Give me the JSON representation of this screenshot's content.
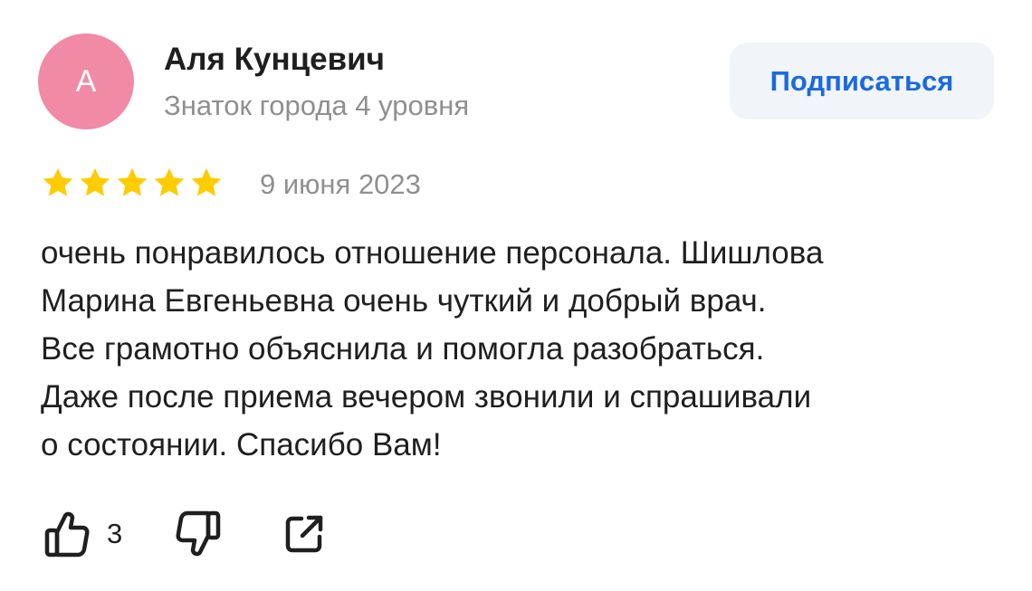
{
  "colors": {
    "avatar_bg": "#f08aa5",
    "accent": "#1a6ae0",
    "star": "#ffcc00",
    "muted": "#8f8f8f",
    "icon": "#1f1f1f"
  },
  "author": {
    "avatar_letter": "А",
    "name": "Аля Кунцевич",
    "level": "Знаток города 4 уровня"
  },
  "subscribe_label": "Подписаться",
  "rating": {
    "value": 5,
    "max": 5
  },
  "date": "9 июня 2023",
  "text_lines": [
    "очень понравилось отношение персонала. Шишлова",
    "Марина Евгеньевна очень чуткий и добрый врач.",
    "Все грамотно объяснила и помогла разобраться.",
    "Даже после приема вечером звонили и спрашивали",
    "о состоянии. Спасибо Вам!"
  ],
  "actions": {
    "like_icon": "thumbs-up-icon",
    "like_count": "3",
    "dislike_icon": "thumbs-down-icon",
    "share_icon": "share-icon"
  }
}
